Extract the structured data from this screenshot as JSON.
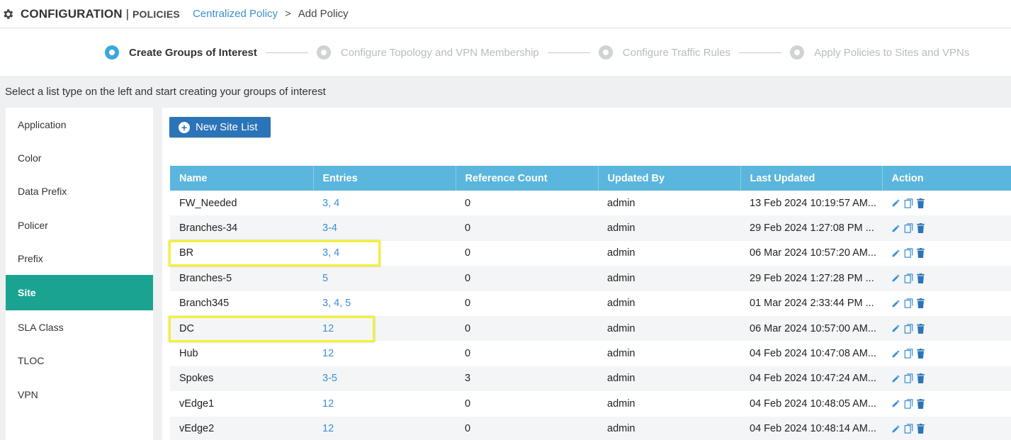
{
  "header": {
    "title": "CONFIGURATION",
    "separator": "|",
    "subtitle": "POLICIES",
    "breadcrumb_link": "Centralized Policy",
    "breadcrumb_arrow": ">",
    "breadcrumb_current": "Add Policy"
  },
  "stepper": {
    "steps": [
      {
        "label": "Create Groups of Interest",
        "active": true
      },
      {
        "label": "Configure Topology and VPN Membership",
        "active": false
      },
      {
        "label": "Configure Traffic Rules",
        "active": false
      },
      {
        "label": "Apply Policies to Sites and VPNs",
        "active": false
      }
    ]
  },
  "instruction": "Select a list type on the left and start creating your groups of interest",
  "sidebar": {
    "items": [
      {
        "label": "Application"
      },
      {
        "label": "Color"
      },
      {
        "label": "Data Prefix"
      },
      {
        "label": "Policer"
      },
      {
        "label": "Prefix"
      },
      {
        "label": "Site",
        "active": true
      },
      {
        "label": "SLA Class"
      },
      {
        "label": "TLOC"
      },
      {
        "label": "VPN"
      }
    ]
  },
  "main": {
    "new_button_label": "New Site List",
    "table": {
      "columns": [
        "Name",
        "Entries",
        "Reference Count",
        "Updated By",
        "Last Updated",
        "Action"
      ],
      "rows": [
        {
          "name": "FW_Needed",
          "entries": "3, 4",
          "ref": "0",
          "by": "admin",
          "last": "13 Feb 2024 10:19:57 AM..."
        },
        {
          "name": "Branches-34",
          "entries": "3-4",
          "ref": "0",
          "by": "admin",
          "last": "29 Feb 2024 1:27:08 PM ..."
        },
        {
          "name": "BR",
          "entries": "3, 4",
          "ref": "0",
          "by": "admin",
          "last": "06 Mar 2024 10:57:20 AM..."
        },
        {
          "name": "Branches-5",
          "entries": "5",
          "ref": "0",
          "by": "admin",
          "last": "29 Feb 2024 1:27:28 PM ..."
        },
        {
          "name": "Branch345",
          "entries": "3, 4, 5",
          "ref": "0",
          "by": "admin",
          "last": "01 Mar 2024 2:33:44 PM ..."
        },
        {
          "name": "DC",
          "entries": "12",
          "ref": "0",
          "by": "admin",
          "last": "06 Mar 2024 10:57:00 AM..."
        },
        {
          "name": "Hub",
          "entries": "12",
          "ref": "0",
          "by": "admin",
          "last": "04 Feb 2024 10:47:08 AM..."
        },
        {
          "name": "Spokes",
          "entries": "3-5",
          "ref": "3",
          "by": "admin",
          "last": "04 Feb 2024 10:47:24 AM..."
        },
        {
          "name": "vEdge1",
          "entries": "12",
          "ref": "0",
          "by": "admin",
          "last": "04 Feb 2024 10:48:05 AM..."
        },
        {
          "name": "vEdge2",
          "entries": "12",
          "ref": "0",
          "by": "admin",
          "last": "04 Feb 2024 10:48:14 AM..."
        }
      ]
    }
  },
  "icons": {
    "gear": "gear-icon",
    "edit": "pencil-icon",
    "copy": "copy-icon",
    "delete": "trash-icon",
    "add": "plus-circle-icon"
  },
  "colors": {
    "accent_blue": "#2b74b7",
    "header_blue": "#5ab6dc",
    "link_blue": "#3a8fd6",
    "active_teal": "#1aa391",
    "highlight_yellow": "#f3f03a"
  }
}
